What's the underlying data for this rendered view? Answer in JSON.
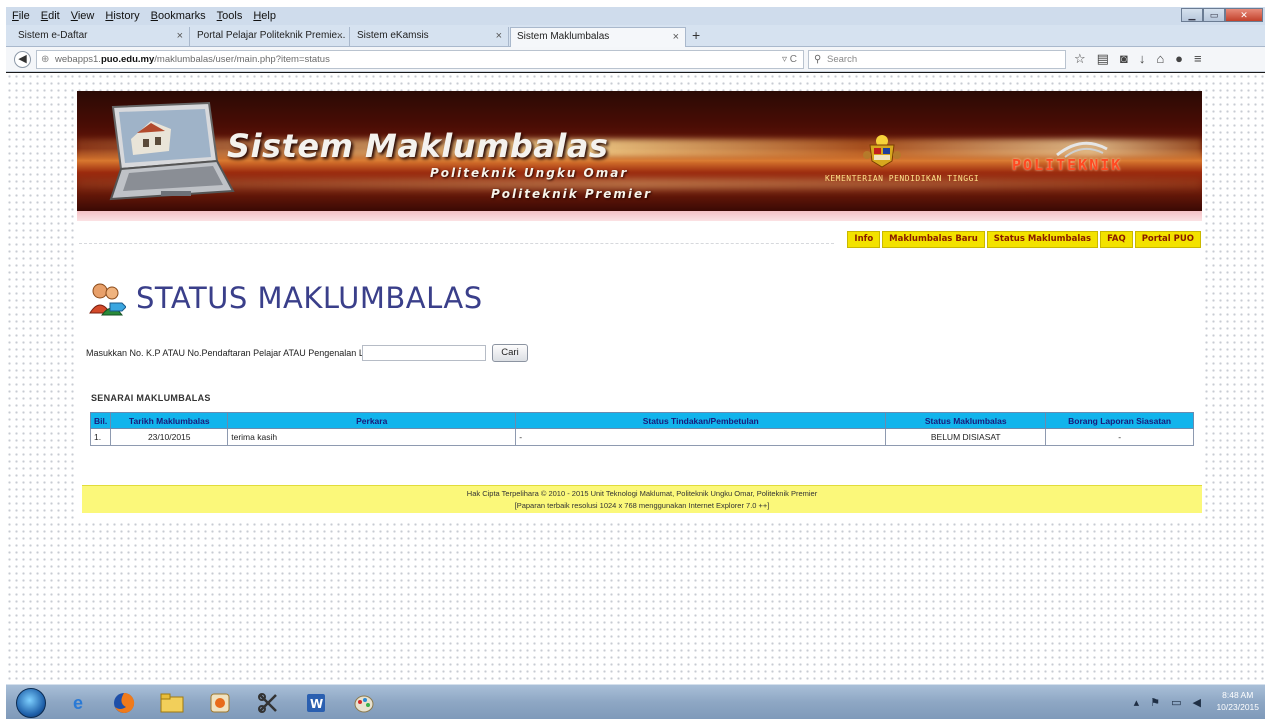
{
  "browser": {
    "menu": [
      "File",
      "Edit",
      "View",
      "History",
      "Bookmarks",
      "Tools",
      "Help"
    ],
    "tabs": [
      {
        "label": "Sistem e-Daftar"
      },
      {
        "label": "Portal Pelajar Politeknik Premie..."
      },
      {
        "label": "Sistem eKamsis"
      },
      {
        "label": "Sistem Maklumbalas",
        "active": true
      }
    ],
    "url_prefix": "webapps1.",
    "url_domain": "puo.edu.my",
    "url_path": "/maklumbalas/user/main.php?item=status",
    "search_placeholder": "Search"
  },
  "banner": {
    "title": "Sistem Maklumbalas",
    "subtitle1": "Politeknik Ungku Omar",
    "subtitle2": "Politeknik Premier",
    "ministry": "KEMENTERIAN PENDIDIKAN TINGGI",
    "logo_text": "POLITEKNIK"
  },
  "nav": {
    "items": [
      "Info",
      "Maklumbalas Baru",
      "Status Maklumbalas",
      "FAQ",
      "Portal PUO"
    ]
  },
  "page": {
    "title": "STATUS MAKLUMBALAS",
    "search_label": "Masukkan No. K.P ATAU No.Pendaftaran Pelajar ATAU Pengenalan Lain :",
    "search_value": "",
    "search_button": "Cari",
    "list_title": "SENARAI MAKLUMBALAS"
  },
  "table": {
    "headers": [
      "Bil.",
      "Tarikh Maklumbalas",
      "Perkara",
      "Status Tindakan/Pembetulan",
      "Status Maklumbalas",
      "Borang Laporan Siasatan"
    ],
    "rows": [
      [
        "1.",
        "23/10/2015",
        "terima kasih",
        "-",
        "BELUM DISIASAT",
        "-"
      ]
    ]
  },
  "footer": {
    "line1": "Hak Cipta Terpelihara © 2010 - 2015 Unit Teknologi Maklumat, Politeknik Ungku Omar, Politeknik Premier",
    "line2": "[Paparan terbaik resolusi 1024 x 768 menggunakan Internet Explorer 7.0 ++]"
  },
  "taskbar": {
    "time": "8:48 AM",
    "date": "10/23/2015"
  },
  "colors": {
    "table_header": "#12b4ec",
    "nav_yellow": "#f3e200",
    "footer_yellow": "#fbf87a",
    "title_blue": "#3a3f8a"
  }
}
